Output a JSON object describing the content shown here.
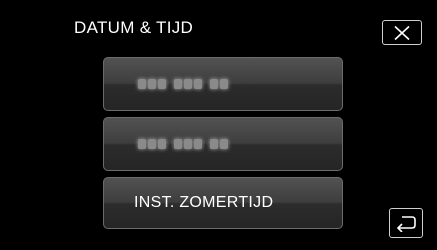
{
  "header": {
    "title": "DATUM & TIJD",
    "close_icon": "close-icon"
  },
  "menu": {
    "items": [
      {
        "label": "",
        "state": "blurred-text"
      },
      {
        "label": "",
        "state": "blurred-text"
      },
      {
        "label": "INST. ZOMERTIJD"
      }
    ]
  },
  "footer": {
    "back_icon": "return-arrow-icon"
  },
  "colors": {
    "background": "#000000",
    "button_gradient_top": "#525252",
    "button_gradient_bottom": "#252525",
    "button_border": "#6c6c6c",
    "text": "#ffffff"
  }
}
